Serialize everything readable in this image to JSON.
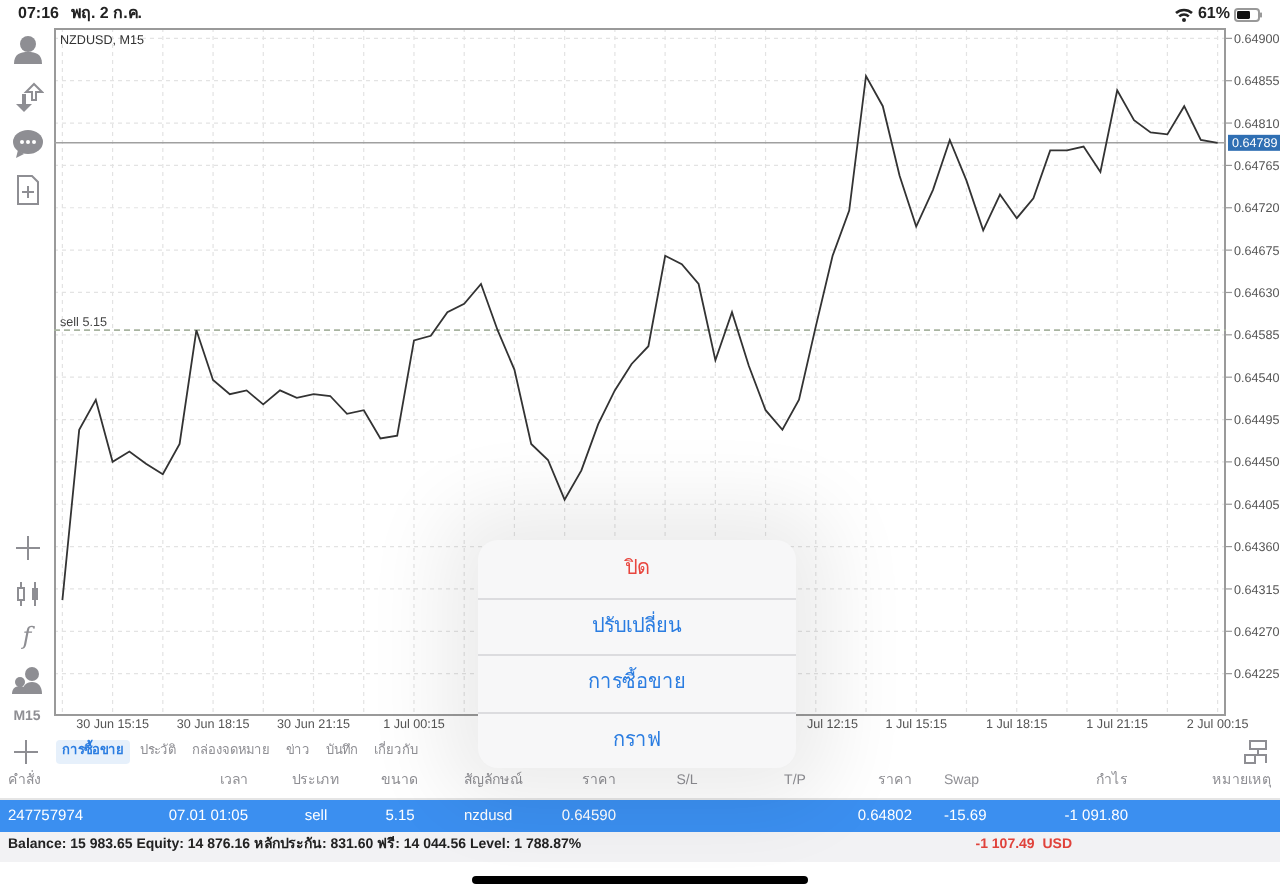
{
  "status_bar": {
    "time": "07:16",
    "date": "พฤ. 2 ก.ค.",
    "battery": "61%"
  },
  "toolbar": {
    "function_symbol": "f",
    "timeframe": "M15"
  },
  "chart": {
    "chart_data": {
      "type": "line",
      "title": "NZDUSD, M15",
      "grid": true,
      "ylim": [
        0.6418,
        0.64911
      ],
      "categories": [
        null,
        null,
        null,
        "30 Jun 15:15",
        null,
        null,
        null,
        null,
        null,
        "30 Jun 18:15",
        null,
        null,
        null,
        null,
        null,
        "30 Jun 21:15",
        null,
        null,
        null,
        null,
        null,
        "1 Jul 00:15",
        null,
        null,
        null,
        null,
        null,
        null,
        null,
        null,
        null,
        null,
        null,
        null,
        null,
        null,
        null,
        null,
        null,
        null,
        null,
        null,
        null,
        null,
        null,
        null,
        "Jul 12:15",
        null,
        null,
        null,
        null,
        "1 Jul 15:15",
        null,
        null,
        null,
        null,
        null,
        "1 Jul 18:15",
        null,
        null,
        null,
        null,
        null,
        "1 Jul 21:15",
        null,
        null,
        null,
        null,
        null,
        "2 Jul 00:15"
      ],
      "yticks": [
        {
          "value": 0.64225,
          "label": "0.64225"
        },
        {
          "value": 0.6427,
          "label": "0.64270"
        },
        {
          "value": 0.64315,
          "label": "0.64315"
        },
        {
          "value": 0.6436,
          "label": "0.64360"
        },
        {
          "value": 0.64405,
          "label": "0.64405"
        },
        {
          "value": 0.6445,
          "label": "0.64450"
        },
        {
          "value": 0.64495,
          "label": "0.64495"
        },
        {
          "value": 0.6454,
          "label": "0.64540"
        },
        {
          "value": 0.64585,
          "label": "0.64585"
        },
        {
          "value": 0.6463,
          "label": "0.64630"
        },
        {
          "value": 0.64675,
          "label": "0.64675"
        },
        {
          "value": 0.6472,
          "label": "0.64720"
        },
        {
          "value": 0.64765,
          "label": "0.64765"
        },
        {
          "value": 0.6481,
          "label": "0.64810"
        },
        {
          "value": 0.64855,
          "label": "0.64855"
        },
        {
          "value": 0.649,
          "label": "0.64900"
        }
      ],
      "series": [
        {
          "color": "#333333",
          "values": [
            0.64303,
            0.64484,
            0.64516,
            0.6445,
            0.64461,
            0.64448,
            0.64437,
            0.64469,
            0.6459,
            0.64537,
            0.64522,
            0.64526,
            0.64511,
            0.64526,
            0.64518,
            0.64522,
            0.6452,
            0.64501,
            0.64505,
            0.64475,
            0.64478,
            0.64579,
            0.64584,
            0.64609,
            0.64618,
            0.64639,
            0.6459,
            0.64548,
            0.64469,
            0.64452,
            0.6441,
            0.64441,
            0.6449,
            0.64526,
            0.64554,
            0.64573,
            0.64669,
            0.6466,
            0.64639,
            0.64558,
            0.64609,
            0.64552,
            0.64505,
            0.64484,
            0.64516,
            0.64594,
            0.64669,
            0.64717,
            0.6486,
            0.64828,
            0.64754,
            0.647,
            0.64739,
            0.64792,
            0.64749,
            0.64696,
            0.64734,
            0.64709,
            0.6473,
            0.64781,
            0.64781,
            0.64785,
            0.64758,
            0.64845,
            0.64813,
            0.648,
            0.64798,
            0.64828,
            0.64792,
            0.64789
          ]
        }
      ],
      "ref_lines": [
        {
          "axis": "y",
          "value": 0.64789,
          "label": "0.64789"
        },
        {
          "axis": "y",
          "value": 0.6459,
          "label": "sell 5.15"
        }
      ]
    }
  },
  "tabs": [
    {
      "label": "การซื้อขาย",
      "selected": true
    },
    {
      "label": "ประวัติ",
      "selected": false
    },
    {
      "label": "กล่องจดหมาย",
      "selected": false
    },
    {
      "label": "ข่าว",
      "selected": false
    },
    {
      "label": "บันทึก",
      "selected": false
    },
    {
      "label": "เกี่ยวกับ",
      "selected": false
    }
  ],
  "table": {
    "columns": [
      "คำสั่ง",
      "เวลา",
      "ประเภท",
      "ขนาด",
      "สัญลักษณ์",
      "ราคา",
      "S/L",
      "T/P",
      "ราคา",
      "Swap",
      "กำไร",
      "หมายเหตุ"
    ],
    "rows": [
      {
        "selected": true,
        "cells": [
          "247757974",
          "07.01 01:05",
          "sell",
          "5.15",
          "nzdusd",
          "0.64590",
          null,
          null,
          "0.64802",
          "-15.69",
          "-1 091.80",
          null
        ]
      }
    ]
  },
  "summary": {
    "text": "Balance: 15 983.65 Equity: 14 876.16 หลักประกัน: 831.60 ฟรี: 14 044.56 Level: 1 788.87%",
    "total": "-1 107.49  USD"
  },
  "action_sheet": {
    "items": [
      {
        "label": "ปิด",
        "kind": "destructive"
      },
      {
        "label": "ปรับเปลี่ยน",
        "kind": "action"
      },
      {
        "label": "การซื้อขาย",
        "kind": "action"
      },
      {
        "label": "กราฟ",
        "kind": "action"
      }
    ]
  }
}
